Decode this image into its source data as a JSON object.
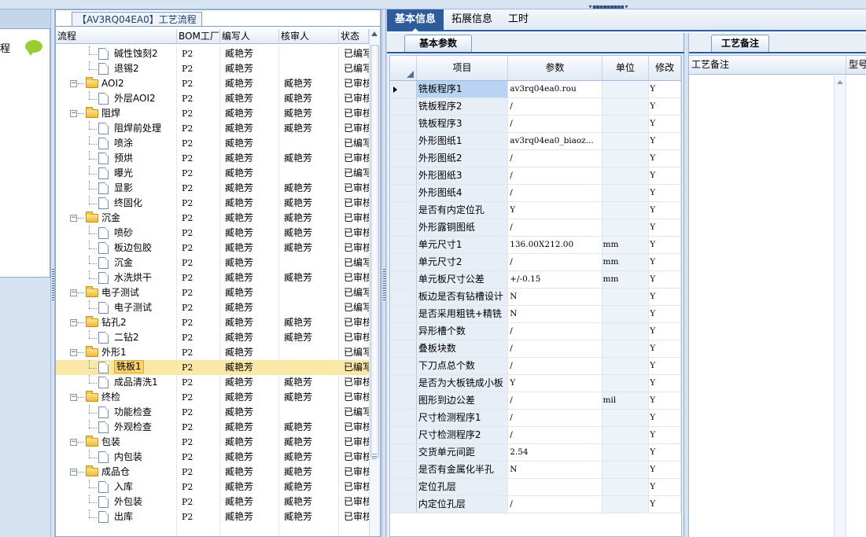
{
  "left_panel": {
    "title_fragment": "程"
  },
  "tree": {
    "title": "【AV3RQ04EA0】工艺流程",
    "headers": {
      "flow": "流程",
      "bom": "BOM工厂",
      "author": "编写人",
      "reviewer": "核审人",
      "status": "状态"
    },
    "rows": [
      {
        "name": "碱性蚀刻2",
        "level": 2,
        "type": "doc",
        "bom": "P2",
        "author": "臧艳芳",
        "reviewer": "",
        "status": "已编写"
      },
      {
        "name": "退锡2",
        "level": 2,
        "type": "doc",
        "bom": "P2",
        "author": "臧艳芳",
        "reviewer": "",
        "status": "已编写"
      },
      {
        "name": "AOI2",
        "level": 1,
        "type": "folder",
        "bom": "P2",
        "author": "臧艳芳",
        "reviewer": "臧艳芳",
        "status": "已审核"
      },
      {
        "name": "外层AOI2",
        "level": 2,
        "type": "doc",
        "bom": "P2",
        "author": "臧艳芳",
        "reviewer": "臧艳芳",
        "status": "已审核"
      },
      {
        "name": "阻焊",
        "level": 1,
        "type": "folder",
        "bom": "P2",
        "author": "臧艳芳",
        "reviewer": "臧艳芳",
        "status": "已审核"
      },
      {
        "name": "阻焊前处理",
        "level": 2,
        "type": "doc",
        "bom": "P2",
        "author": "臧艳芳",
        "reviewer": "臧艳芳",
        "status": "已审核"
      },
      {
        "name": "喷涂",
        "level": 2,
        "type": "doc",
        "bom": "P2",
        "author": "臧艳芳",
        "reviewer": "",
        "status": "已编写"
      },
      {
        "name": "预烘",
        "level": 2,
        "type": "doc",
        "bom": "P2",
        "author": "臧艳芳",
        "reviewer": "臧艳芳",
        "status": "已审核"
      },
      {
        "name": "曝光",
        "level": 2,
        "type": "doc",
        "bom": "P2",
        "author": "臧艳芳",
        "reviewer": "",
        "status": "已编写"
      },
      {
        "name": "显影",
        "level": 2,
        "type": "doc",
        "bom": "P2",
        "author": "臧艳芳",
        "reviewer": "臧艳芳",
        "status": "已审核"
      },
      {
        "name": "终固化",
        "level": 2,
        "type": "doc",
        "bom": "P2",
        "author": "臧艳芳",
        "reviewer": "臧艳芳",
        "status": "已审核"
      },
      {
        "name": "沉金",
        "level": 1,
        "type": "folder",
        "bom": "P2",
        "author": "臧艳芳",
        "reviewer": "臧艳芳",
        "status": "已审核"
      },
      {
        "name": "喷砂",
        "level": 2,
        "type": "doc",
        "bom": "P2",
        "author": "臧艳芳",
        "reviewer": "臧艳芳",
        "status": "已审核"
      },
      {
        "name": "板边包胶",
        "level": 2,
        "type": "doc",
        "bom": "P2",
        "author": "臧艳芳",
        "reviewer": "臧艳芳",
        "status": "已审核"
      },
      {
        "name": "沉金",
        "level": 2,
        "type": "doc",
        "bom": "P2",
        "author": "臧艳芳",
        "reviewer": "",
        "status": "已编写"
      },
      {
        "name": "水洗烘干",
        "level": 2,
        "type": "doc",
        "bom": "P2",
        "author": "臧艳芳",
        "reviewer": "臧艳芳",
        "status": "已审核"
      },
      {
        "name": "电子测试",
        "level": 1,
        "type": "folder",
        "bom": "P2",
        "author": "臧艳芳",
        "reviewer": "",
        "status": "已编写"
      },
      {
        "name": "电子测试",
        "level": 2,
        "type": "doc",
        "bom": "P2",
        "author": "臧艳芳",
        "reviewer": "",
        "status": "已编写"
      },
      {
        "name": "钻孔2",
        "level": 1,
        "type": "folder",
        "bom": "P2",
        "author": "臧艳芳",
        "reviewer": "臧艳芳",
        "status": "已审核"
      },
      {
        "name": "二钻2",
        "level": 2,
        "type": "doc",
        "bom": "P2",
        "author": "臧艳芳",
        "reviewer": "臧艳芳",
        "status": "已审核"
      },
      {
        "name": "外形1",
        "level": 1,
        "type": "folder",
        "bom": "P2",
        "author": "臧艳芳",
        "reviewer": "",
        "status": "已编写"
      },
      {
        "name": "铣板1",
        "level": 2,
        "type": "doc",
        "bom": "P2",
        "author": "臧艳芳",
        "reviewer": "",
        "status": "已编写",
        "selected": true
      },
      {
        "name": "成品清洗1",
        "level": 2,
        "type": "doc",
        "bom": "P2",
        "author": "臧艳芳",
        "reviewer": "臧艳芳",
        "status": "已审核"
      },
      {
        "name": "终检",
        "level": 1,
        "type": "folder",
        "bom": "P2",
        "author": "臧艳芳",
        "reviewer": "臧艳芳",
        "status": "已审核"
      },
      {
        "name": "功能检查",
        "level": 2,
        "type": "doc",
        "bom": "P2",
        "author": "臧艳芳",
        "reviewer": "",
        "status": "已编写"
      },
      {
        "name": "外观检查",
        "level": 2,
        "type": "doc",
        "bom": "P2",
        "author": "臧艳芳",
        "reviewer": "臧艳芳",
        "status": "已审核"
      },
      {
        "name": "包装",
        "level": 1,
        "type": "folder",
        "bom": "P2",
        "author": "臧艳芳",
        "reviewer": "臧艳芳",
        "status": "已审核"
      },
      {
        "name": "内包装",
        "level": 2,
        "type": "doc",
        "bom": "P2",
        "author": "臧艳芳",
        "reviewer": "臧艳芳",
        "status": "已审核"
      },
      {
        "name": "成品仓",
        "level": 1,
        "type": "folder",
        "bom": "P2",
        "author": "臧艳芳",
        "reviewer": "臧艳芳",
        "status": "已审核"
      },
      {
        "name": "入库",
        "level": 2,
        "type": "doc",
        "bom": "P2",
        "author": "臧艳芳",
        "reviewer": "臧艳芳",
        "status": "已审核"
      },
      {
        "name": "外包装",
        "level": 2,
        "type": "doc",
        "bom": "P2",
        "author": "臧艳芳",
        "reviewer": "臧艳芳",
        "status": "已审核"
      },
      {
        "name": "出库",
        "level": 2,
        "type": "doc",
        "bom": "P2",
        "author": "臧艳芳",
        "reviewer": "臧艳芳",
        "status": "已审核"
      }
    ]
  },
  "tabs": [
    {
      "label": "基本信息",
      "active": true
    },
    {
      "label": "拓展信息",
      "active": false
    },
    {
      "label": "工时",
      "active": false
    }
  ],
  "basic_params": {
    "tab_label": "基本参数",
    "headers": {
      "item": "项目",
      "param": "参数",
      "unit": "单位",
      "mod": "修改"
    },
    "rows": [
      {
        "item": "铣板程序1",
        "param": "av3rq04ea0.rou",
        "unit": "",
        "mod": "Y",
        "current": true
      },
      {
        "item": "铣板程序2",
        "param": "/",
        "unit": "",
        "mod": "Y"
      },
      {
        "item": "铣板程序3",
        "param": "/",
        "unit": "",
        "mod": "Y"
      },
      {
        "item": "外形图纸1",
        "param": "av3rq04ea0_biaoz...",
        "unit": "",
        "mod": "Y"
      },
      {
        "item": "外形图纸2",
        "param": "/",
        "unit": "",
        "mod": "Y"
      },
      {
        "item": "外形图纸3",
        "param": "/",
        "unit": "",
        "mod": "Y"
      },
      {
        "item": "外形图纸4",
        "param": "/",
        "unit": "",
        "mod": "Y"
      },
      {
        "item": "是否有内定位孔",
        "param": "Y",
        "unit": "",
        "mod": "Y"
      },
      {
        "item": "外形露铜图纸",
        "param": "/",
        "unit": "",
        "mod": "Y"
      },
      {
        "item": "单元尺寸1",
        "param": "136.00X212.00",
        "unit": "mm",
        "mod": "Y"
      },
      {
        "item": "单元尺寸2",
        "param": "/",
        "unit": "mm",
        "mod": "Y"
      },
      {
        "item": "单元板尺寸公差",
        "param": "+/-0.15",
        "unit": "mm",
        "mod": "Y"
      },
      {
        "item": "板边是否有钻槽设计",
        "param": "N",
        "unit": "",
        "mod": "Y"
      },
      {
        "item": "是否采用粗铣+精铣",
        "param": "N",
        "unit": "",
        "mod": "Y"
      },
      {
        "item": "异形槽个数",
        "param": "/",
        "unit": "",
        "mod": "Y"
      },
      {
        "item": "叠板块数",
        "param": "/",
        "unit": "",
        "mod": "Y"
      },
      {
        "item": "下刀点总个数",
        "param": "/",
        "unit": "",
        "mod": "Y"
      },
      {
        "item": "是否为大板铣成小板",
        "param": "Y",
        "unit": "",
        "mod": "Y"
      },
      {
        "item": "图形到边公差",
        "param": "/",
        "unit": "mil",
        "mod": "Y"
      },
      {
        "item": "尺寸检测程序1",
        "param": "/",
        "unit": "",
        "mod": "Y"
      },
      {
        "item": "尺寸检测程序2",
        "param": "/",
        "unit": "",
        "mod": "Y"
      },
      {
        "item": "交货单元间距",
        "param": "2.54",
        "unit": "",
        "mod": "Y"
      },
      {
        "item": "是否有金属化半孔",
        "param": "N",
        "unit": "",
        "mod": "Y"
      },
      {
        "item": "定位孔层",
        "param": "",
        "unit": "",
        "mod": "Y"
      },
      {
        "item": "内定位孔层",
        "param": "/",
        "unit": "",
        "mod": "Y"
      }
    ]
  },
  "notes": {
    "tab_label": "工艺备注",
    "headers": {
      "note": "工艺备注",
      "model": "型号"
    }
  },
  "colors": {
    "accent": "#2d5c9d",
    "selection": "#fbe7a6",
    "folder": "#f2b931"
  }
}
